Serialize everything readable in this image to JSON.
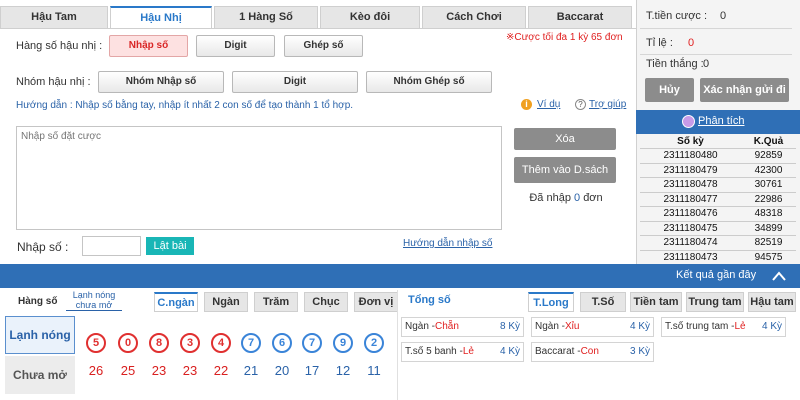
{
  "tabs": [
    "Hậu Tam",
    "Hậu Nhị",
    "1 Hàng Số",
    "Kèo đôi",
    "Cách Chơi",
    "Baccarat"
  ],
  "row1": {
    "label": "Hàng số hậu nhị :",
    "buttons": [
      "Nhập số",
      "Digit",
      "Ghép số"
    ],
    "note": "※Cược tối đa 1 kỳ 65 đơn"
  },
  "row2": {
    "label": "Nhóm hậu nhị :",
    "buttons": [
      "Nhóm Nhập số",
      "Digit",
      "Nhóm Ghép số"
    ]
  },
  "guide": {
    "text": "Hướng dẫn : Nhập số bằng tay, nhập ít nhất 2 con số để tạo thành 1 tổ hợp.",
    "example": "Ví dụ",
    "help": "Trợ giúp"
  },
  "input": {
    "placeholder": "Nhập số đặt cược",
    "label": "Nhập số :",
    "flip": "Lật bài",
    "guide_link": "Hướng dẫn nhập số"
  },
  "actions": {
    "delete": "Xóa",
    "add": "Thêm vào D.sách",
    "entered_prefix": "Đã nhập",
    "entered_count": "0",
    "entered_suffix": "đơn"
  },
  "right": {
    "total_label": "T.tiền cược :",
    "total_value": "0",
    "rate_label": "Tỉ lệ :",
    "rate_value": "0",
    "win_label": "Tiền thắng :",
    "win_value": "0",
    "cancel": "Hủy",
    "confirm": "Xác nhận gửi đi",
    "analysis": "Phân tích",
    "col_period": "Số kỳ",
    "col_result": "K.Quả",
    "history": [
      {
        "period": "2311180480",
        "result": "92859"
      },
      {
        "period": "2311180479",
        "result": "42300"
      },
      {
        "period": "2311180478",
        "result": "30761"
      },
      {
        "period": "2311180477",
        "result": "22986"
      },
      {
        "period": "2311180476",
        "result": "48318"
      },
      {
        "period": "2311180475",
        "result": "34899"
      },
      {
        "period": "2311180474",
        "result": "82519"
      },
      {
        "period": "2311180473",
        "result": "94575"
      }
    ]
  },
  "recent_bar": {
    "label": "Kết quả gần đây"
  },
  "bottom": {
    "hangso": "Hàng số",
    "lanhnong_small": "Lạnh nóng chưa mở",
    "positions": [
      "C.ngàn",
      "Ngàn",
      "Trăm",
      "Chục",
      "Đơn vị"
    ],
    "row_hot": "Lạnh nóng",
    "row_cold": "Chưa mở",
    "circles": [
      "5",
      "0",
      "8",
      "3",
      "4",
      "7",
      "6",
      "7",
      "9",
      "2"
    ],
    "counts": [
      "26",
      "25",
      "23",
      "23",
      "22",
      "21",
      "20",
      "17",
      "12",
      "11"
    ],
    "tongso": "Tổng số",
    "stat_tabs": [
      "T.Long",
      "T.Số",
      "Tiền tam",
      "Trung tam",
      "Hậu tam"
    ],
    "stats": [
      {
        "name": "Ngàn -",
        "value": "Chẵn",
        "ky": "8 Kỳ"
      },
      {
        "name": "Ngàn -",
        "value": "Xỉu",
        "ky": "4 Kỳ"
      },
      {
        "name": "T.số trung tam -",
        "value": "Lẻ",
        "ky": "4 Kỳ"
      },
      {
        "name": "T.số 5 banh -",
        "value": "Lẻ",
        "ky": "4 Kỳ"
      },
      {
        "name": "Baccarat -",
        "value": "Con",
        "ky": "3 Kỳ"
      }
    ]
  },
  "colors": {
    "accent": "#2a79c9",
    "bar": "#2f6fb6",
    "red": "#e02020"
  }
}
